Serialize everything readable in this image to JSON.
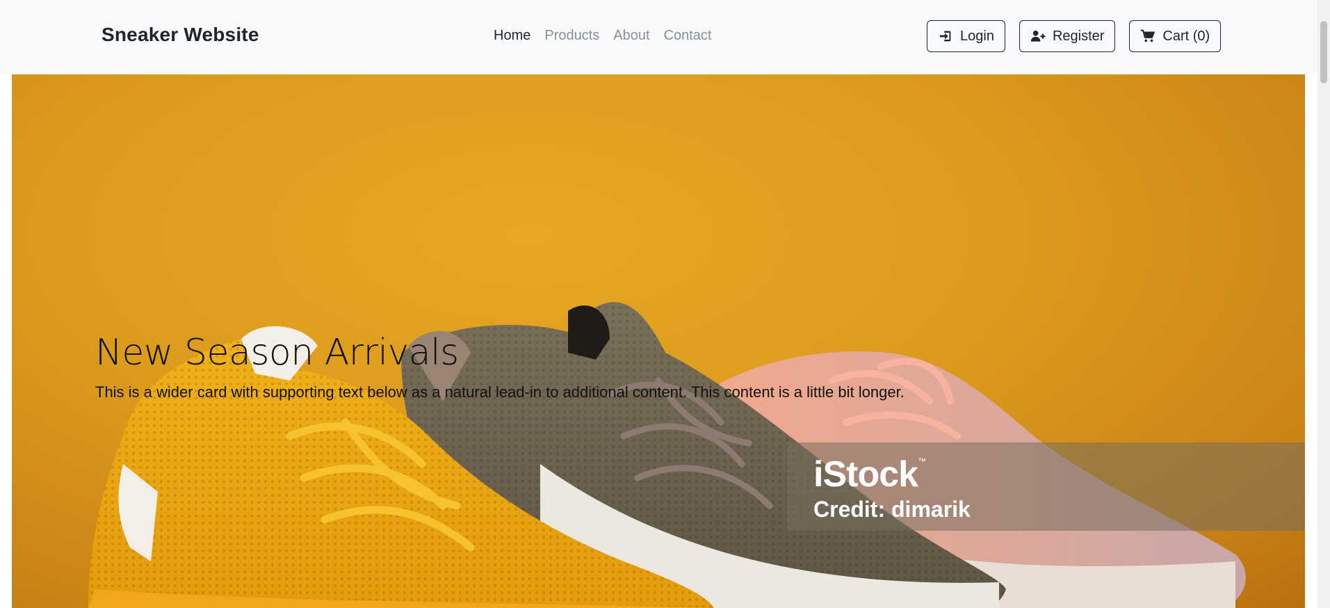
{
  "navbar": {
    "brand": "Sneaker Website",
    "links": [
      {
        "label": "Home",
        "active": true
      },
      {
        "label": "Products",
        "active": false
      },
      {
        "label": "About",
        "active": false
      },
      {
        "label": "Contact",
        "active": false
      }
    ],
    "buttons": {
      "login": {
        "label": "Login",
        "icon": "sign-in-icon"
      },
      "register": {
        "label": "Register",
        "icon": "user-plus-icon"
      },
      "cart": {
        "label": "Cart (0)",
        "icon": "cart-icon"
      }
    }
  },
  "hero": {
    "title": "New Season Arrivals",
    "text": "This is a wider card with supporting text below as a natural lead-in to additional content. This content is a little bit longer.",
    "watermark": {
      "brand": "iStock",
      "trademark": "™",
      "credit": "Credit: dimarik"
    }
  },
  "colors": {
    "navbar_bg": "#f8f9fa",
    "hero_bg": "#dc9a1c",
    "text_dark": "#212529",
    "nav_muted": "#8c8f92"
  }
}
